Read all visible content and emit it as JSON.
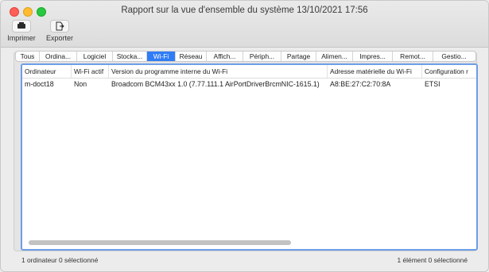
{
  "window": {
    "title": "Rapport sur la vue d'ensemble du système 13/10/2021 17:56"
  },
  "toolbar": {
    "print_label": "Imprimer",
    "export_label": "Exporter"
  },
  "tabs": [
    {
      "label": "Tous"
    },
    {
      "label": "Ordina..."
    },
    {
      "label": "Logiciel"
    },
    {
      "label": "Stocka..."
    },
    {
      "label": "Wi-Fi",
      "active": true
    },
    {
      "label": "Réseau"
    },
    {
      "label": "Affich..."
    },
    {
      "label": "Périph..."
    },
    {
      "label": "Partage"
    },
    {
      "label": "Alimen..."
    },
    {
      "label": "Impres..."
    },
    {
      "label": "Remot..."
    },
    {
      "label": "Gestio..."
    }
  ],
  "table": {
    "columns": [
      "Ordinateur",
      "Wi-Fi actif",
      "Version du programme interne du Wi-Fi",
      "Adresse matérielle du Wi-Fi",
      "Configuration r"
    ],
    "rows": [
      [
        "m-doct18",
        "Non",
        "Broadcom BCM43xx 1.0 (7.77.111.1 AirPortDriverBrcmNIC-1615.1)",
        "A8:BE:27:C2:70:8A",
        "ETSI"
      ]
    ]
  },
  "status": {
    "left": "1 ordinateur 0 sélectionné",
    "right": "1 élément 0 sélectionné"
  },
  "colors": {
    "accent": "#2f7cf6",
    "selection_border": "#6d9ee8"
  }
}
